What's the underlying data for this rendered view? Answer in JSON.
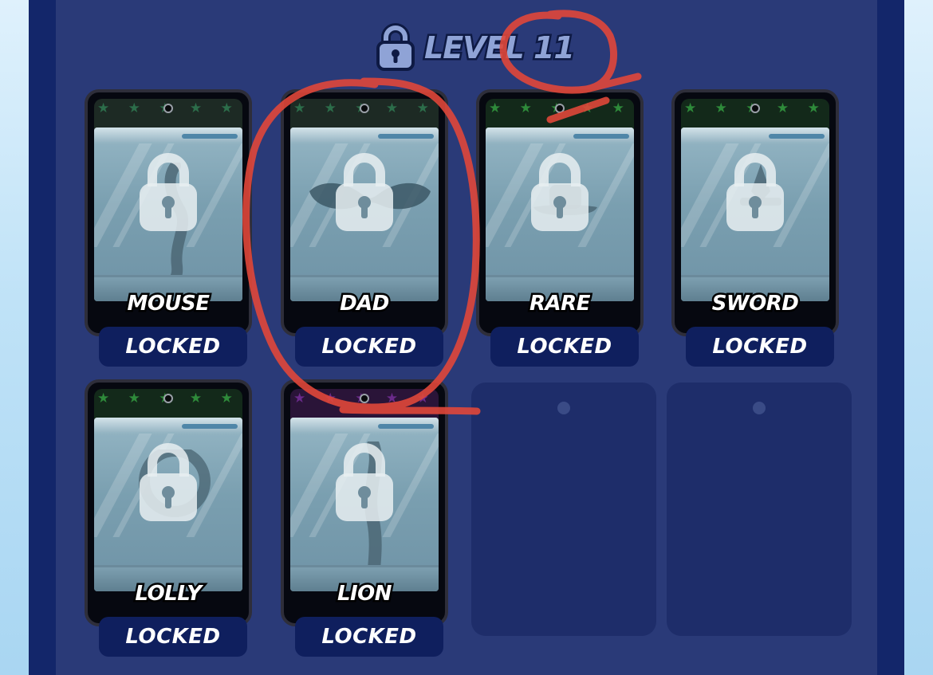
{
  "header": {
    "level_label": "LEVEL 11",
    "icon": "lock-icon"
  },
  "colors": {
    "rim_blue": "#a9d8ea",
    "rim_green": "#6ddc3a",
    "rim_purple": "#cf3ef0",
    "annotation": "#e0473a"
  },
  "cards": [
    {
      "name": "MOUSE",
      "status": "LOCKED",
      "rarity_rim": "#b7dde9",
      "star": "#2c6d4a",
      "top": "#1d2a24"
    },
    {
      "name": "DAD",
      "status": "LOCKED",
      "rarity_rim": "#b7dde9",
      "star": "#2c6d4a",
      "top": "#1d2a24"
    },
    {
      "name": "RARE",
      "status": "LOCKED",
      "rarity_rim": "#6ddc3a",
      "star": "#2e8a3a",
      "top": "#13291a"
    },
    {
      "name": "SWORD",
      "status": "LOCKED",
      "rarity_rim": "#6ddc3a",
      "star": "#2e8a3a",
      "top": "#13291a"
    },
    {
      "name": "LOLLY",
      "status": "LOCKED",
      "rarity_rim": "#6ddc3a",
      "star": "#2e8a3a",
      "top": "#13291a"
    },
    {
      "name": "LION",
      "status": "LOCKED",
      "rarity_rim": "#cf3ef0",
      "star": "#6a2a8a",
      "top": "#2a1438"
    }
  ],
  "empty_slots": 2
}
